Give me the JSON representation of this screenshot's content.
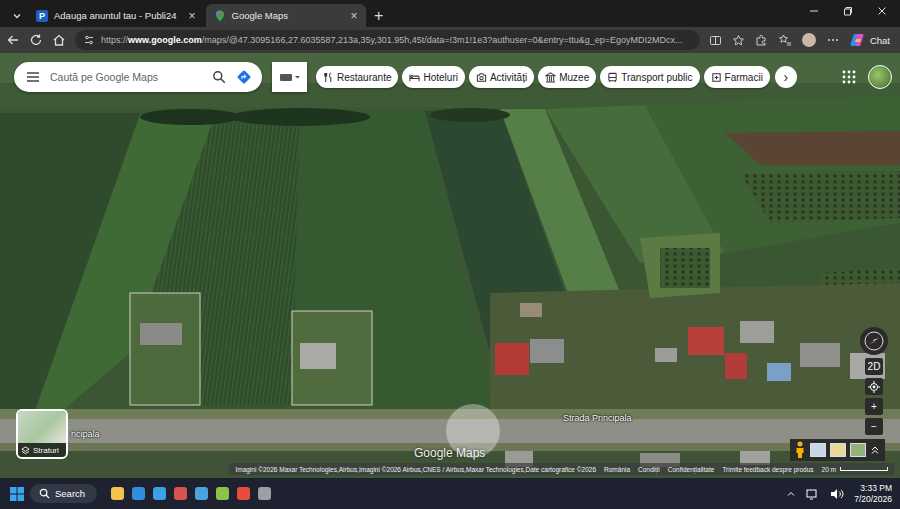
{
  "browser": {
    "tabs": [
      {
        "label": "Adauga anuntul tau - Publi24",
        "favicon": "P",
        "selected": false,
        "close": "×"
      },
      {
        "label": "Google Maps",
        "favicon": "",
        "selected": true,
        "close": "×"
      }
    ],
    "new_tab": "+",
    "url": {
      "scheme": "https://",
      "host": "www.google.com",
      "path": "/maps/@47.3095166,27.6035587,213a,35y,301.95h,45t/data=!3m1!1e3?authuser=0&entry=ttu&g_ep=EgoyMDI2MDcx..."
    },
    "chat": "Chat"
  },
  "maps": {
    "search": {
      "placeholder": "Caută pe Google Maps"
    },
    "chips": [
      "Restaurante",
      "Hoteluri",
      "Activități",
      "Muzee",
      "Transport public",
      "Farmacii"
    ],
    "chips_next": "›",
    "layers": "Straturi",
    "road_labels": [
      "Strada Principala",
      "ncipala"
    ],
    "watermark": "Google Maps",
    "view_toggle": "2D",
    "zoom_in": "+",
    "zoom_out": "−",
    "attribution": {
      "imagery": "Imagini ©2026 Maxar Technologies,Airbus,Imagini ©2026 Airbus,CNES / Airbus,Maxar Technologies,Date cartografice ©2026",
      "links": [
        "România",
        "Condiții",
        "Confidențialitate",
        "Trimite feedback despre produs"
      ],
      "scale": "20 m"
    }
  },
  "taskbar": {
    "search": "Search",
    "time": "3:33 PM",
    "date": "7/20/2026"
  }
}
